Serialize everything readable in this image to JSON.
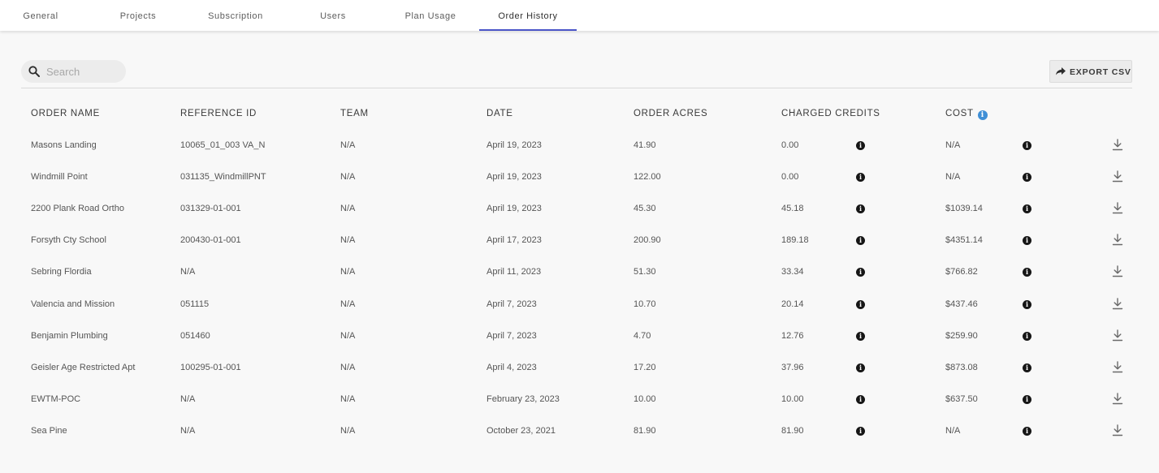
{
  "tabs": [
    {
      "label": "General"
    },
    {
      "label": "Projects"
    },
    {
      "label": "Subscription"
    },
    {
      "label": "Users"
    },
    {
      "label": "Plan Usage"
    },
    {
      "label": "Order History",
      "active": true
    }
  ],
  "search": {
    "placeholder": "Search",
    "value": ""
  },
  "export": {
    "label": "EXPORT CSV"
  },
  "colors": {
    "accent": "#4a55c8",
    "info_blue": "#3f8fd6",
    "info_dark": "#161616"
  },
  "icons": {
    "search": "search-icon",
    "export": "share-arrow-icon",
    "info": "info-icon",
    "download": "download-icon"
  },
  "table": {
    "headers": {
      "order_name": "ORDER NAME",
      "reference_id": "REFERENCE ID",
      "team": "TEAM",
      "date": "DATE",
      "order_acres": "ORDER ACRES",
      "charged_credits": "CHARGED CREDITS",
      "cost": "COST"
    },
    "rows": [
      {
        "name": "Masons Landing",
        "ref": "10065_01_003 VA_N",
        "team": "N/A",
        "date": "April 19, 2023",
        "acres": "41.90",
        "credits": "0.00",
        "cost": "N/A"
      },
      {
        "name": "Windmill Point",
        "ref": "031135_WindmillPNT",
        "team": "N/A",
        "date": "April 19, 2023",
        "acres": "122.00",
        "credits": "0.00",
        "cost": "N/A"
      },
      {
        "name": "2200 Plank Road Ortho",
        "ref": "031329-01-001",
        "team": "N/A",
        "date": "April 19, 2023",
        "acres": "45.30",
        "credits": "45.18",
        "cost": "$1039.14"
      },
      {
        "name": "Forsyth Cty School",
        "ref": "200430-01-001",
        "team": "N/A",
        "date": "April 17, 2023",
        "acres": "200.90",
        "credits": "189.18",
        "cost": "$4351.14"
      },
      {
        "name": "Sebring Flordia",
        "ref": "N/A",
        "team": "N/A",
        "date": "April 11, 2023",
        "acres": "51.30",
        "credits": "33.34",
        "cost": "$766.82"
      },
      {
        "name": "Valencia and Mission",
        "ref": "051115",
        "team": "N/A",
        "date": "April 7, 2023",
        "acres": "10.70",
        "credits": "20.14",
        "cost": "$437.46"
      },
      {
        "name": "Benjamin Plumbing",
        "ref": "051460",
        "team": "N/A",
        "date": "April 7, 2023",
        "acres": "4.70",
        "credits": "12.76",
        "cost": "$259.90"
      },
      {
        "name": "Geisler Age Restricted Apt",
        "ref": "100295-01-001",
        "team": "N/A",
        "date": "April 4, 2023",
        "acres": "17.20",
        "credits": "37.96",
        "cost": "$873.08"
      },
      {
        "name": "EWTM-POC",
        "ref": "N/A",
        "team": "N/A",
        "date": "February 23, 2023",
        "acres": "10.00",
        "credits": "10.00",
        "cost": "$637.50"
      },
      {
        "name": "Sea Pine",
        "ref": "N/A",
        "team": "N/A",
        "date": "October 23, 2021",
        "acres": "81.90",
        "credits": "81.90",
        "cost": "N/A"
      }
    ]
  }
}
